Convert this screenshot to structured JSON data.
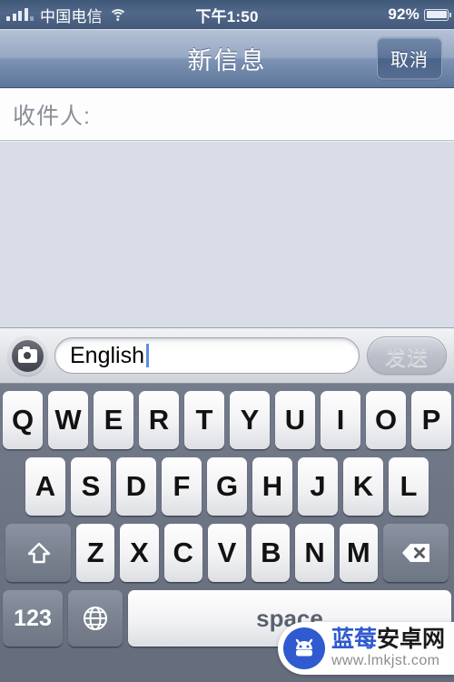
{
  "status_bar": {
    "signal_icon": "signal-bars-icon",
    "carrier": "中国电信",
    "wifi_icon": "wifi-icon",
    "time": "下午1:50",
    "battery_percent": "92%",
    "battery_icon": "battery-icon"
  },
  "nav_bar": {
    "title": "新信息",
    "cancel_label": "取消"
  },
  "recipient": {
    "label": "收件人:",
    "value": "",
    "placeholder": ""
  },
  "toolbar": {
    "camera_icon": "camera-icon",
    "message_value": "English",
    "message_placeholder": "",
    "send_label": "发送",
    "send_enabled": false
  },
  "keyboard": {
    "row1": [
      "Q",
      "W",
      "E",
      "R",
      "T",
      "Y",
      "U",
      "I",
      "O",
      "P"
    ],
    "row2": [
      "A",
      "S",
      "D",
      "F",
      "G",
      "H",
      "J",
      "K",
      "L"
    ],
    "row3": [
      "Z",
      "X",
      "C",
      "V",
      "B",
      "N",
      "M"
    ],
    "shift_icon": "shift-icon",
    "backspace_icon": "backspace-icon",
    "numbers_label": "123",
    "globe_icon": "globe-icon",
    "space_label": "space"
  },
  "watermark": {
    "logo_icon": "android-robot-icon",
    "name_part1": "蓝莓",
    "name_part2": "安卓网",
    "url": "www.lmkjst.com"
  },
  "colors": {
    "navbar_top": "#b6c2d6",
    "navbar_bottom": "#5e7699",
    "body_bg": "#d8dde8",
    "keyboard_bg": "#6c7484",
    "caret": "#5b8fe0",
    "watermark_blue": "#2f5ad0"
  }
}
